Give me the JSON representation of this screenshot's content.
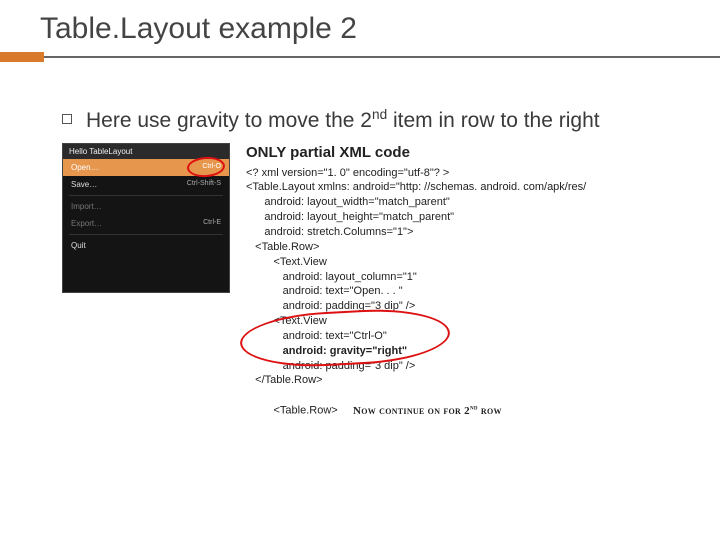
{
  "title": "Table.Layout example 2",
  "bullet": {
    "prefix": "Here use gravity to move the 2",
    "sup": "nd",
    "suffix": " item in row to the right"
  },
  "menu": {
    "header": "Hello TableLayout",
    "items": [
      {
        "label": "Open…",
        "shortcut": "Ctrl-O",
        "hover": true
      },
      {
        "label": "Save…",
        "shortcut": "Ctrl-Shift-S"
      }
    ],
    "items2": [
      {
        "label": "Import…",
        "shortcut": ""
      },
      {
        "label": "Export…",
        "shortcut": "Ctrl-E"
      }
    ],
    "items3": [
      {
        "label": "Quit",
        "shortcut": ""
      }
    ]
  },
  "code": {
    "heading": "ONLY partial XML code",
    "l1": "<? xml version=\"1. 0\" encoding=\"utf-8\"? >",
    "l2": "<Table.Layout xmlns: android=\"http: //schemas. android. com/apk/res/",
    "l3": "      android: layout_width=\"match_parent\"",
    "l4": "      android: layout_height=\"match_parent\"",
    "l5": "      android: stretch.Columns=\"1\">",
    "l6": "",
    "l7": "   <Table.Row>",
    "l8": "         <Text.View",
    "l9": "            android: layout_column=\"1\"",
    "l10": "            android: text=\"Open. . . \"",
    "l11": "            android: padding=\"3 dip\" />",
    "l12": "         <Text.View",
    "l13": "            android: text=\"Ctrl-O\"",
    "l14": "            android: gravity=\"right\"",
    "l15": "            android: padding=\"3 dip\" />",
    "l16": "   </Table.Row>",
    "l17": "",
    "l18a": "   <Table.Row>     ",
    "l18b": "Now continue on for 2",
    "l18sup": "nd",
    "l18c": " row"
  }
}
